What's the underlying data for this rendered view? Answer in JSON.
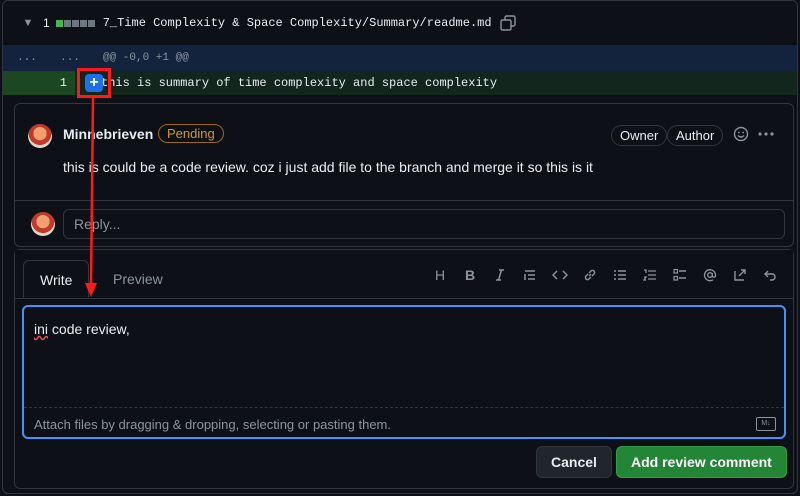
{
  "file": {
    "collapse_icon": "chevron-down-icon",
    "changes_count": "1",
    "path": "7_Time Complexity & Space Complexity/Summary/readme.md",
    "copy_icon": "copy-icon"
  },
  "diff": {
    "old_line": "...",
    "new_line": "...",
    "hunk_header": "@@ -0,0 +1 @@",
    "line_number": "1",
    "line_content": "this is summary of time complexity and space complexity",
    "add_button_symbol": "+"
  },
  "comment": {
    "author": "Minnebrieven",
    "status": "Pending",
    "role_owner": "Owner",
    "role_author": "Author",
    "body": "this is could be a code review. coz i just add file to the branch and merge it so this is it",
    "reply_placeholder": "Reply..."
  },
  "editor": {
    "tab_write": "Write",
    "tab_preview": "Preview",
    "text_misspelled": "ini",
    "text_rest": " code review,",
    "attach_hint": "Attach files by dragging & dropping, selecting or pasting them.",
    "markdown_badge": "M↓",
    "toolbar_heading": "H",
    "toolbar_bold": "B",
    "cancel_label": "Cancel",
    "submit_label": "Add review comment"
  },
  "colors": {
    "accent_blue": "#1f6feb",
    "pending_text": "#d29922",
    "submit_green": "#238636",
    "annotation_red": "#ff1a1a"
  }
}
